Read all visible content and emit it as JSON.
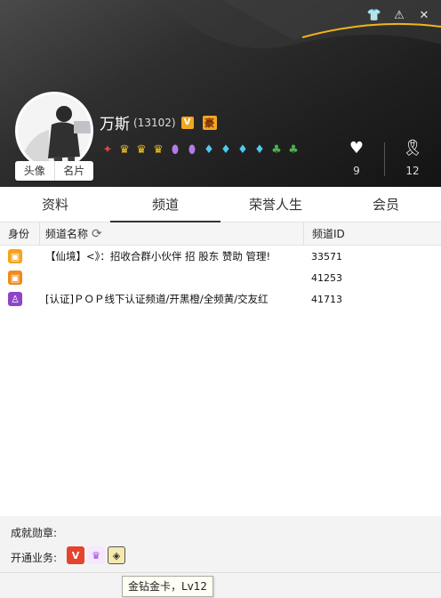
{
  "window": {
    "icons": [
      "shirt-icon",
      "warning-icon",
      "close-icon"
    ]
  },
  "profile": {
    "avatar_button": "头像",
    "card_button": "名片",
    "name": "万斯",
    "uid": "(13102)",
    "v_badge": "V",
    "hao_badge": "豪",
    "medals": [
      "wing-badge",
      "crown",
      "crown",
      "crown",
      "shield",
      "shield",
      "diamond",
      "diamond",
      "diamond",
      "diamond",
      "clover",
      "clover"
    ],
    "likes": "9",
    "awards": "12"
  },
  "tabs": [
    {
      "label": "资料"
    },
    {
      "label": "频道",
      "active": true
    },
    {
      "label": "荣誉人生"
    },
    {
      "label": "会员"
    }
  ],
  "table": {
    "headers": {
      "role": "身份",
      "name": "频道名称",
      "id": "频道ID"
    },
    "rows": [
      {
        "role_icon": "gift-icon",
        "name": "【仙境】<》：招收合群小伙伴  招  股东  赞助  管理!",
        "id": "33571"
      },
      {
        "role_icon": "gift-icon",
        "name": "",
        "id": "41253"
      },
      {
        "role_icon": "member-icon",
        "name": "[认证]ＰＯＰ线下认证频道/开黑橙/全频黄/交友红",
        "id": "41713"
      }
    ]
  },
  "footer": {
    "achievements_label": "成就勋章:",
    "services_label": "开通业务:",
    "services": [
      "v-service-icon",
      "purple-service-icon",
      "gold-diamond-card-icon"
    ],
    "tooltip": "金钻金卡，Lv12"
  },
  "colors": {
    "header_bg": "#1f1f1f",
    "gold_accent": "#f2b21c"
  }
}
